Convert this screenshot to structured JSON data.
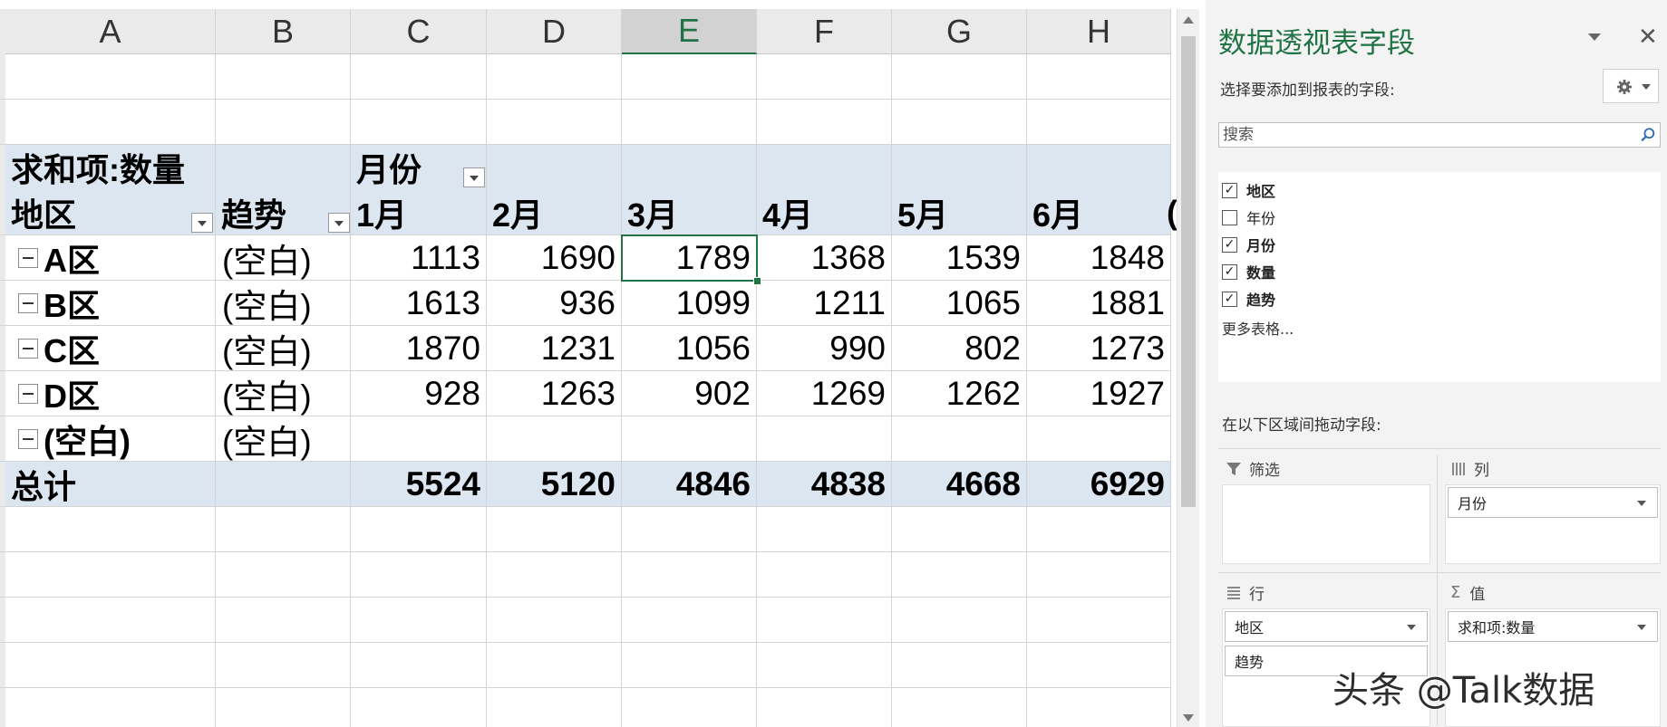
{
  "columns": [
    "A",
    "B",
    "C",
    "D",
    "E",
    "F",
    "G",
    "H"
  ],
  "selected_column": "E",
  "pivot": {
    "value_label": "求和项:数量",
    "col_field": "月份",
    "row_field": "地区",
    "row_field2": "趋势",
    "months": [
      "1月",
      "2月",
      "3月",
      "4月",
      "5月",
      "6月"
    ],
    "overflow_char": "(",
    "rows": [
      {
        "region": "A区",
        "trend": "(空白)",
        "values": [
          "1113",
          "1690",
          "1789",
          "1368",
          "1539",
          "1848"
        ]
      },
      {
        "region": "B区",
        "trend": "(空白)",
        "values": [
          "1613",
          "936",
          "1099",
          "1211",
          "1065",
          "1881"
        ]
      },
      {
        "region": "C区",
        "trend": "(空白)",
        "values": [
          "1870",
          "1231",
          "1056",
          "990",
          "802",
          "1273"
        ]
      },
      {
        "region": "D区",
        "trend": "(空白)",
        "values": [
          "928",
          "1263",
          "902",
          "1269",
          "1262",
          "1927"
        ]
      },
      {
        "region": "(空白)",
        "trend": "(空白)",
        "values": [
          "",
          "",
          "",
          "",
          "",
          ""
        ]
      }
    ],
    "total_label": "总计",
    "totals": [
      "5524",
      "5120",
      "4846",
      "4838",
      "4668",
      "6929"
    ]
  },
  "pane": {
    "title": "数据透视表字段",
    "subtitle": "选择要添加到报表的字段:",
    "search_placeholder": "搜索",
    "fields": [
      {
        "name": "地区",
        "checked": true
      },
      {
        "name": "年份",
        "checked": false
      },
      {
        "name": "月份",
        "checked": true
      },
      {
        "name": "数量",
        "checked": true
      },
      {
        "name": "趋势",
        "checked": true
      }
    ],
    "more_tables": "更多表格...",
    "drag_label": "在以下区域间拖动字段:",
    "areas": {
      "filter": {
        "label": "筛选"
      },
      "columns": {
        "label": "列",
        "items": [
          "月份"
        ]
      },
      "rows": {
        "label": "行",
        "items": [
          "地区",
          "趋势"
        ]
      },
      "values": {
        "label": "值",
        "items": [
          "求和项:数量"
        ]
      }
    }
  },
  "watermark": "头条 @Talk数据",
  "accent_color": "#217346",
  "band_color": "#dce6f1"
}
